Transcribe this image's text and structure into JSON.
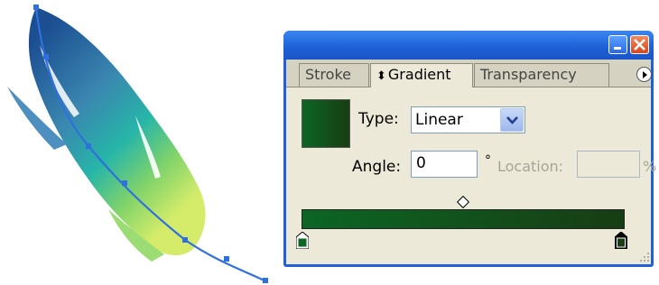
{
  "window": {
    "minimize_icon": "minimize-icon",
    "close_icon": "close-icon"
  },
  "tabs": [
    {
      "label": "Stroke",
      "active": false
    },
    {
      "label": "Gradient",
      "active": true,
      "icon": "diamond-arrows-icon"
    },
    {
      "label": "Transparency",
      "active": false
    }
  ],
  "gradient": {
    "type_label": "Type:",
    "type_value": "Linear",
    "angle_label": "Angle:",
    "angle_value": "0",
    "angle_unit": "°",
    "location_label": "Location:",
    "location_value": "",
    "location_unit": "%",
    "start_color": "#0c6624",
    "end_color": "#173d13",
    "midpoint_percent": 50
  },
  "colors": {
    "title_bar": "#2060d8",
    "panel_bg": "#ece9d8"
  }
}
